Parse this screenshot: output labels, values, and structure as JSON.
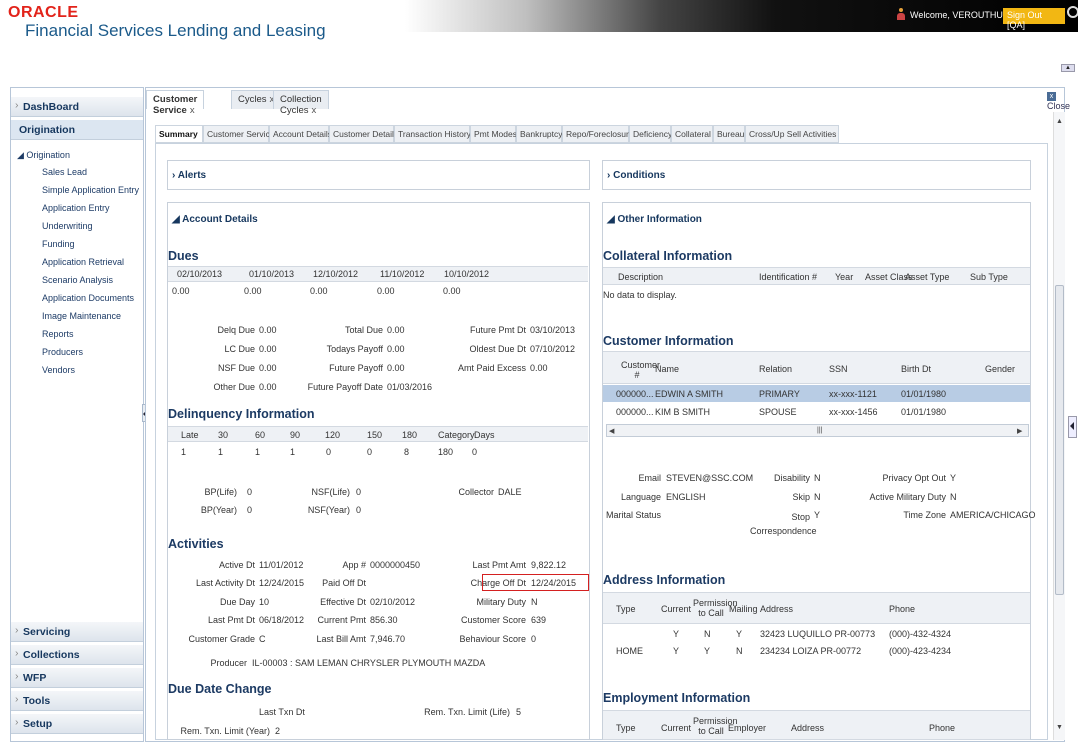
{
  "header": {
    "logo_oracle": "ORACLE",
    "product": "Financial Services Lending and Leasing",
    "welcome": "Welcome, VEROUTHU ▾",
    "signout": "Sign Out [QA]"
  },
  "nav": {
    "dashboard": "DashBoard",
    "origination": "Origination",
    "tree_root": "◢ Origination",
    "items": [
      "Sales Lead",
      "Simple Application Entry",
      "Application Entry",
      "Underwriting",
      "Funding",
      "Application Retrieval",
      "Scenario Analysis",
      "Application Documents",
      "Image Maintenance",
      "Reports",
      "Producers",
      "Vendors"
    ],
    "bottom": [
      "Servicing",
      "Collections",
      "WFP",
      "Tools",
      "Setup"
    ]
  },
  "tabs": [
    {
      "label": "Customer Service"
    },
    {
      "label": "Cycles"
    },
    {
      "label": "Collection Cycles"
    }
  ],
  "tab_close": "x",
  "close_label": "Close",
  "subtabs": [
    "Summary",
    "Customer Service",
    "Account Details",
    "Customer Details",
    "Transaction History",
    "Pmt Modes",
    "Bankruptcy",
    "Repo/Foreclosure",
    "Deficiency",
    "Collateral",
    "Bureau",
    "Cross/Up Sell Activities"
  ],
  "alerts_title": "Alerts",
  "conditions_title": "Conditions",
  "account_details": {
    "title": "Account Details",
    "dues_title": "Dues",
    "dues_dates": [
      "02/10/2013",
      "01/10/2013",
      "12/10/2012",
      "11/10/2012",
      "10/10/2012"
    ],
    "dues_values": [
      "0.00",
      "0.00",
      "0.00",
      "0.00",
      "0.00"
    ],
    "summary": [
      {
        "label": "Delq Due",
        "value": "0.00"
      },
      {
        "label": "Total Due",
        "value": "0.00"
      },
      {
        "label": "Future Pmt Dt",
        "value": "03/10/2013"
      },
      {
        "label": "LC Due",
        "value": "0.00"
      },
      {
        "label": "Todays Payoff",
        "value": "0.00"
      },
      {
        "label": "Oldest Due Dt",
        "value": "07/10/2012"
      },
      {
        "label": "NSF Due",
        "value": "0.00"
      },
      {
        "label": "Future Payoff",
        "value": "0.00"
      },
      {
        "label": "Amt Paid Excess",
        "value": "0.00"
      },
      {
        "label": "Other Due",
        "value": "0.00"
      },
      {
        "label": "Future Payoff Date",
        "value": "01/03/2016"
      }
    ],
    "delinq_title": "Delinquency Information",
    "delinq_headers": [
      "Late",
      "30",
      "60",
      "90",
      "120",
      "150",
      "180",
      "Category",
      "Days"
    ],
    "delinq_values": [
      "1",
      "1",
      "1",
      "1",
      "0",
      "0",
      "8",
      "180",
      "0"
    ],
    "bp": [
      {
        "label": "BP(Life)",
        "value": "0"
      },
      {
        "label": "NSF(Life)",
        "value": "0"
      },
      {
        "label": "Collector",
        "value": "DALE"
      },
      {
        "label": "BP(Year)",
        "value": "0"
      },
      {
        "label": "NSF(Year)",
        "value": "0"
      }
    ],
    "activities_title": "Activities",
    "activities": [
      {
        "label": "Active Dt",
        "value": "11/01/2012"
      },
      {
        "label": "App #",
        "value": "0000000450"
      },
      {
        "label": "Last Pmt Amt",
        "value": "9,822.12"
      },
      {
        "label": "Last Activity Dt",
        "value": "12/24/2015"
      },
      {
        "label": "Paid Off Dt",
        "value": ""
      },
      {
        "label": "Charge Off Dt",
        "value": "12/24/2015"
      },
      {
        "label": "Due Day",
        "value": "10"
      },
      {
        "label": "Effective Dt",
        "value": "02/10/2012"
      },
      {
        "label": "Military Duty",
        "value": "N"
      },
      {
        "label": "Last Pmt Dt",
        "value": "06/18/2012"
      },
      {
        "label": "Current Pmt",
        "value": "856.30"
      },
      {
        "label": "Customer Score",
        "value": "639"
      },
      {
        "label": "Customer Grade",
        "value": "C"
      },
      {
        "label": "Last Bill Amt",
        "value": "7,946.70"
      },
      {
        "label": "Behaviour Score",
        "value": "0"
      }
    ],
    "producer_label": "Producer",
    "producer_value": "IL-00003 : SAM LEMAN CHRYSLER PLYMOUTH MAZDA",
    "due_change_title": "Due Date Change",
    "last_txn_label": "Last Txn Dt",
    "rem_life_label": "Rem. Txn. Limit (Life)",
    "rem_life_value": "5",
    "rem_year_label": "Rem. Txn. Limit (Year)",
    "rem_year_value": "2"
  },
  "other_info": {
    "title": "Other Information",
    "collateral_title": "Collateral Information",
    "collateral_headers": [
      "Description",
      "Identification #",
      "Year",
      "Asset Class",
      "Asset Type",
      "Sub Type"
    ],
    "no_data": "No data to display.",
    "customer_title": "Customer Information",
    "customer_headers": [
      "Customer #",
      "Name",
      "Relation",
      "SSN",
      "Birth Dt",
      "Gender"
    ],
    "customers": [
      {
        "id": "000000...",
        "name": "EDWIN A SMITH",
        "relation": "PRIMARY",
        "ssn": "xx-xxx-1121",
        "birth": "01/01/1980",
        "gender": ""
      },
      {
        "id": "000000...",
        "name": "KIM B SMITH",
        "relation": "SPOUSE",
        "ssn": "xx-xxx-1456",
        "birth": "01/01/1980",
        "gender": ""
      }
    ],
    "details": [
      {
        "label": "Email",
        "value": "STEVEN@SSC.COM"
      },
      {
        "label": "Disability",
        "value": "N"
      },
      {
        "label": "Privacy Opt Out",
        "value": "Y"
      },
      {
        "label": "Language",
        "value": "ENGLISH"
      },
      {
        "label": "Skip",
        "value": "N"
      },
      {
        "label": "Active Military Duty",
        "value": "N"
      },
      {
        "label": "Marital Status",
        "value": ""
      },
      {
        "label": "Stop Correspondence",
        "value": "Y"
      },
      {
        "label": "Time Zone",
        "value": "AMERICA/CHICAGO"
      }
    ],
    "address_title": "Address Information",
    "address_headers": [
      "Type",
      "Current",
      "Permission to Call",
      "Mailing",
      "Address",
      "Phone"
    ],
    "addresses": [
      {
        "type": "",
        "current": "Y",
        "permission": "N",
        "mailing": "Y",
        "address": "32423 LUQUILLO PR-00773",
        "phone": "(000)-432-4324"
      },
      {
        "type": "HOME",
        "current": "Y",
        "permission": "Y",
        "mailing": "N",
        "address": "234234 LOIZA PR-00772",
        "phone": "(000)-423-4234"
      }
    ],
    "employment_title": "Employment Information",
    "employment_headers": [
      "Type",
      "Current",
      "Permission to Call",
      "Employer",
      "Address",
      "Phone"
    ]
  }
}
